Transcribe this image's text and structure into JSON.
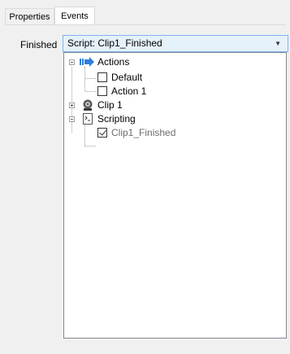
{
  "tabs": [
    {
      "label": "Properties",
      "active": false
    },
    {
      "label": "Events",
      "active": true
    }
  ],
  "event": {
    "label": "Finished",
    "selected_value": "Script: Clip1_Finished"
  },
  "tree": [
    {
      "label": "Actions",
      "icon": "arrow-icon",
      "expanded": true,
      "children": [
        {
          "label": "Default",
          "checked": false
        },
        {
          "label": "Action 1",
          "checked": false
        }
      ]
    },
    {
      "label": "Clip 1",
      "icon": "clip-icon",
      "expanded": false
    },
    {
      "label": "Scripting",
      "icon": "script-icon",
      "expanded": true,
      "children": [
        {
          "label": "Clip1_Finished",
          "checked": true,
          "disabled": true
        }
      ]
    }
  ],
  "colors": {
    "combo_border": "#7eb4ea",
    "combo_bg": "#e5f1fb",
    "arrow_blue": "#2f7fd8"
  }
}
